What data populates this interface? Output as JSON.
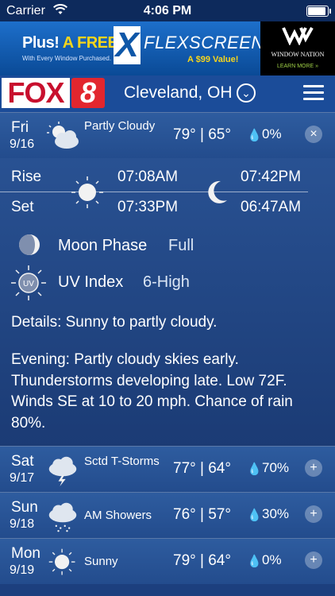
{
  "status": {
    "carrier": "Carrier",
    "time": "4:06 PM"
  },
  "ad": {
    "plus": "Plus!",
    "free": "A FREE",
    "sub": "With Every Window Purchased.",
    "brand": "FLEXSCREEN",
    "value": "A $99 Value!",
    "partner": "WINDOW NATION",
    "learn": "LEARN MORE »"
  },
  "header": {
    "fox": "FOX",
    "eight": "8",
    "city": "Cleveland, OH"
  },
  "today": {
    "day": "Fri",
    "date": "9/16",
    "condition": "Partly Cloudy",
    "high": "79°",
    "low": "65°",
    "precip": "0%"
  },
  "sun": {
    "rise_label": "Rise",
    "set_label": "Set",
    "sunrise": "07:08AM",
    "sunset": "07:33PM"
  },
  "moon": {
    "rise": "07:42PM",
    "set": "06:47AM",
    "phase_label": "Moon Phase",
    "phase": "Full"
  },
  "uv": {
    "label": "UV Index",
    "value": "6-High",
    "icon_text": "UV"
  },
  "details": "Details: Sunny to partly cloudy.",
  "evening": "Evening: Partly cloudy skies early. Thunderstorms developing late. Low 72F. Winds SE at 10 to 20 mph. Chance of rain 80%.",
  "forecast": [
    {
      "day": "Sat",
      "date": "9/17",
      "condition": "Sctd T-Storms",
      "high": "77°",
      "low": "64°",
      "precip": "70%",
      "icon": "thunderstorm-icon"
    },
    {
      "day": "Sun",
      "date": "9/18",
      "condition": "AM Showers",
      "high": "76°",
      "low": "57°",
      "precip": "30%",
      "icon": "showers-icon"
    },
    {
      "day": "Mon",
      "date": "9/19",
      "condition": "Sunny",
      "high": "79°",
      "low": "64°",
      "precip": "0%",
      "icon": "sun-icon"
    }
  ]
}
